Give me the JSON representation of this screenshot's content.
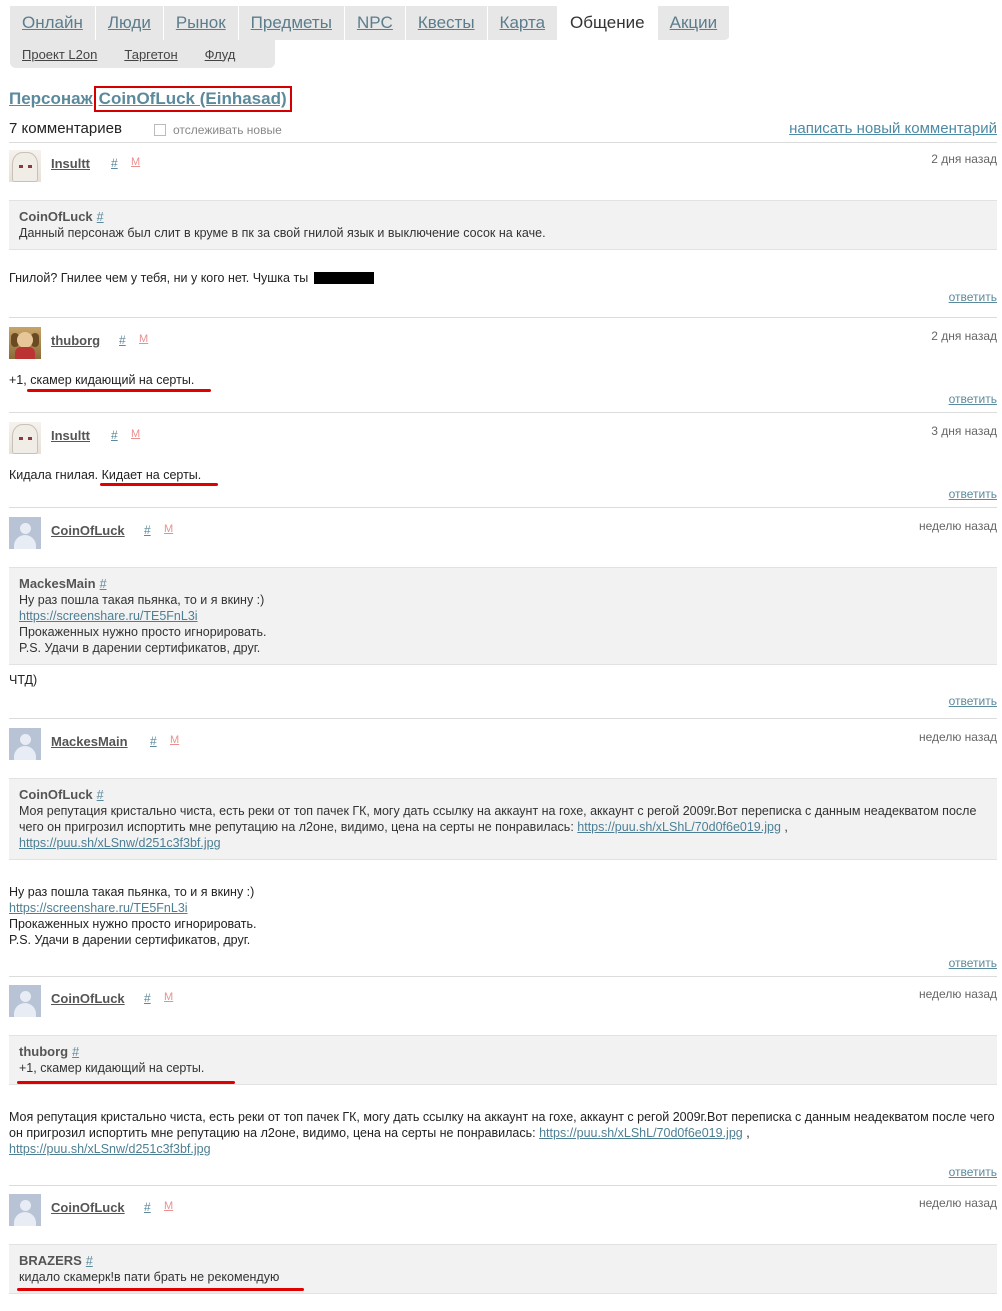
{
  "nav": {
    "tabs": [
      {
        "label": "Онлайн"
      },
      {
        "label": "Люди"
      },
      {
        "label": "Рынок"
      },
      {
        "label": "Предметы"
      },
      {
        "label": "NPC"
      },
      {
        "label": "Квесты"
      },
      {
        "label": "Карта"
      },
      {
        "label": "Общение"
      },
      {
        "label": "Акции"
      }
    ],
    "active": "Общение",
    "subtabs": [
      {
        "label": "Проект L2on"
      },
      {
        "label": "Таргетон"
      },
      {
        "label": "Флуд"
      }
    ]
  },
  "page": {
    "title_prefix": "Персонаж",
    "title_char": "CoinOfLuck (Einhasad)",
    "comment_count": "7 комментариев",
    "watch_label": "отслеживать новые",
    "new_comment_link": "написать новый комментарий",
    "reply_label": "ответить",
    "hash": "#",
    "m": "M"
  },
  "comments": [
    {
      "author": "Insultt",
      "time": "2 дня назад",
      "avatar": "anime-avatar",
      "quote": {
        "author": "CoinOfLuck",
        "text": "Данный персонаж был слит в круме в пк за свой гнилой язык и выключение сосок на каче."
      },
      "text": "Гнилой? Гнилее чем у тебя, ни у кого нет. Чушка ты"
    },
    {
      "author": "thuborg",
      "time": "2 дня назад",
      "avatar": "dog-avatar",
      "text": "+1, скамер кидающий на серты."
    },
    {
      "author": "Insultt",
      "time": "3 дня назад",
      "avatar": "anime-avatar",
      "text": "Кидала гнилая. Кидает на серты."
    },
    {
      "author": "CoinOfLuck",
      "time": "неделю назад",
      "avatar": "default-avatar",
      "quote": {
        "author": "MackesMain",
        "line1": "Ну раз пошла такая пьянка, то и я вкину :)",
        "link1": "https://screenshare.ru/TE5FnL3i",
        "line2": "Прокаженных нужно просто игнорировать.",
        "line3": "P.S. Удачи в дарении сертификатов, друг."
      },
      "text": "ЧТД)"
    },
    {
      "author": "MackesMain",
      "time": "неделю назад",
      "avatar": "default-avatar",
      "quote": {
        "author": "CoinOfLuck",
        "text1": "Моя репутация кристально чиста, есть реки от топ пачек ГК, могу дать ссылку на аккаунт на гохе, аккаунт с регой 2009г.Вот переписка с данным неадекватом после чего он пригрозил испортить мне репутацию на л2оне, видимо, цена на серты не понравилась:",
        "link1": "https://puu.sh/xLShL/70d0f6e019.jpg",
        "sep": ",",
        "link2": "https://puu.sh/xLSnw/d251c3f3bf.jpg"
      },
      "line1": "Ну раз пошла такая пьянка, то и я вкину :)",
      "link1": "https://screenshare.ru/TE5FnL3i",
      "line2": "Прокаженных нужно просто игнорировать.",
      "line3": "P.S. Удачи в дарении сертификатов, друг."
    },
    {
      "author": "CoinOfLuck",
      "time": "неделю назад",
      "avatar": "default-avatar",
      "quote": {
        "author": "thuborg",
        "text": "+1, скамер кидающий на серты."
      },
      "text1": "Моя репутация кристально чиста, есть реки от топ пачек ГК, могу дать ссылку на аккаунт на гохе, аккаунт с регой 2009г.Вот переписка с данным неадекватом после чего он пригрозил испортить мне репутацию на л2оне, видимо, цена на серты не понравилась:",
      "link1": "https://puu.sh/xLShL/70d0f6e019.jpg",
      "sep": ",",
      "link2": "https://puu.sh/xLSnw/d251c3f3bf.jpg"
    },
    {
      "author": "CoinOfLuck",
      "time": "неделю назад",
      "avatar": "default-avatar",
      "quote": {
        "author": "BRAZERS",
        "text": "кидало скамерк!в пати брать не рекомендую"
      }
    }
  ],
  "colors": {
    "link": "#4d7f94",
    "highlight": "#d40000",
    "underline_mark": "#e00000"
  }
}
